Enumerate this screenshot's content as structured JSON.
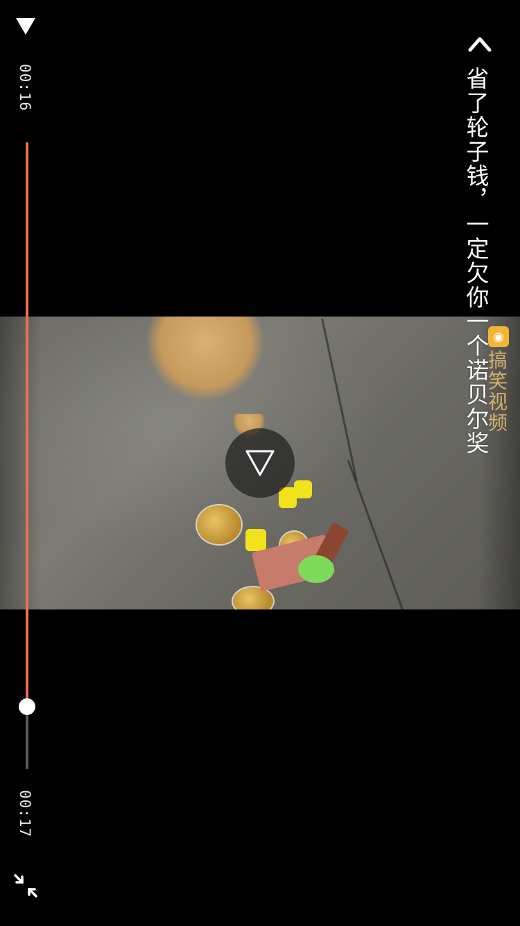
{
  "player": {
    "title": "省了轮子钱，一定欠你一个诺贝尔奖",
    "current_time": "00:16",
    "total_time": "00:17",
    "progress": 0.9,
    "state": "paused",
    "watermark": "搞笑视频"
  },
  "colors": {
    "accent": "#f0714a",
    "track": "#5d5d5d",
    "background": "#000000"
  },
  "icons": {
    "top_play": "play-icon",
    "center_play": "play-icon",
    "back": "chevron-left-icon",
    "exit_fullscreen": "exit-fullscreen-icon"
  }
}
